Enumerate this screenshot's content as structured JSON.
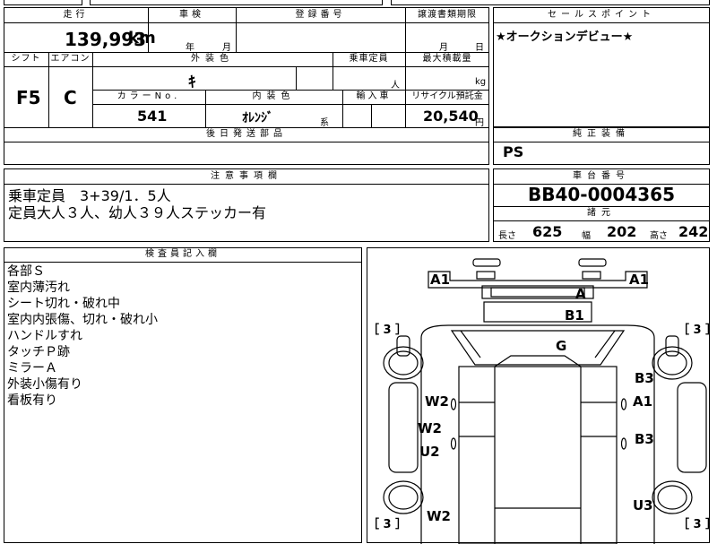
{
  "header": {
    "mileage_label": "走行",
    "mileage_value": "139,993",
    "mileage_unit": "km",
    "shaken_label": "車検",
    "shaken_year_unit": "年",
    "shaken_month_unit": "月",
    "registration_label": "登録番号",
    "registration_value": "",
    "transfer_doc_label": "譲渡書類期限",
    "transfer_month_unit": "月",
    "transfer_day_unit": "日"
  },
  "specs": {
    "shift_label": "シフト",
    "shift_value": "F5",
    "aircon_label": "エアコン",
    "aircon_value": "C",
    "exterior_color_label": "外装色",
    "exterior_color_value": "ｷ",
    "capacity_label": "乗車定員",
    "capacity_unit": "人",
    "max_load_label": "最大積載量",
    "max_load_unit": "kg",
    "color_no_label": "カラーNo.",
    "color_no_value": "541",
    "interior_color_label": "内装色",
    "interior_color_value": "ｵﾚﾝｼﾞ",
    "interior_color_suffix": "系",
    "import_label": "輸入車",
    "recycle_label": "リサイクル預託金",
    "recycle_value": "20,540",
    "recycle_unit": "円",
    "later_parts_label": "後日発送部品"
  },
  "selling_points": {
    "label": "セールスポイント",
    "text": "★オークションデビュー★"
  },
  "equipment": {
    "label": "純正装備",
    "text": "PS"
  },
  "notes": {
    "label": "注意事項欄",
    "line1": "乗車定員　3+39/1．5人",
    "line2": "定員大人３人、幼人３９人ステッカー有"
  },
  "chassis": {
    "label": "車台番号",
    "number": "BB40-0004365",
    "specs_label": "諸元",
    "length_label": "長さ",
    "length_value": "625",
    "width_label": "幅",
    "width_value": "202",
    "height_label": "高さ",
    "height_value": "242"
  },
  "inspector": {
    "label": "検査員記入欄",
    "lines": [
      "各部Ｓ",
      "室内薄汚れ",
      "シート切れ・破れ中",
      "室内内張傷、切れ・破れ小",
      "ハンドルすれ",
      "タッチＰ跡",
      "ミラーＡ",
      "外装小傷有り",
      "看板有り"
    ]
  },
  "diagram": {
    "marks": [
      "A1",
      "A1",
      "A",
      "B1",
      "G",
      "B3",
      "W2",
      "A1",
      "W2",
      "B3",
      "U2",
      "W2",
      "U3"
    ],
    "tire_marks": [
      "［ 3 ］",
      "［ 3 ］",
      "［ 3 ］",
      "［ 3 ］"
    ]
  }
}
